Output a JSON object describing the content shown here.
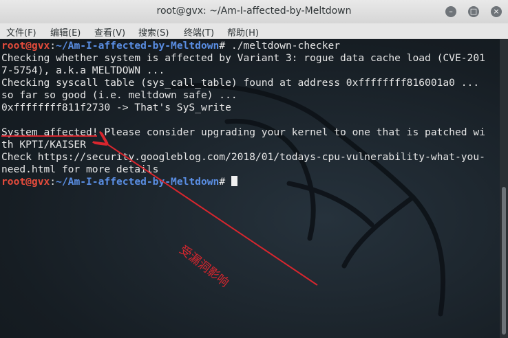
{
  "window": {
    "title": "root@gvx: ~/Am-I-affected-by-Meltdown",
    "controls": {
      "minimize": "–",
      "maximize": "□",
      "close": "×"
    }
  },
  "menu": [
    "文件(F)",
    "编辑(E)",
    "查看(V)",
    "搜索(S)",
    "终端(T)",
    "帮助(H)"
  ],
  "terminal": {
    "prompt1": {
      "user": "root@gvx",
      "sep": ":",
      "path": "~/Am-I-affected-by-Meltdown",
      "hash": "#",
      "cmd": " ./meltdown-checker"
    },
    "lines": [
      "Checking whether system is affected by Variant 3: rogue data cache load (CVE-201",
      "7-5754), a.k.a MELTDOWN ...",
      "Checking syscall table (sys_call_table) found at address 0xffffffff816001a0 ...",
      "so far so good (i.e. meltdown safe) ...",
      "0xffffffff811f2730 -> That's SyS_write",
      "",
      "System affected! Please consider upgrading your kernel to one that is patched wi",
      "th KPTI/KAISER",
      "Check https://security.googleblog.com/2018/01/todays-cpu-vulnerability-what-you-",
      "need.html for more details"
    ],
    "prompt2": {
      "user": "root@gvx",
      "sep": ":",
      "path": "~/Am-I-affected-by-Meltdown",
      "hash": "#",
      "cmd": " "
    }
  },
  "annotation": {
    "text": "受漏洞影响",
    "color": "#d8262e"
  }
}
